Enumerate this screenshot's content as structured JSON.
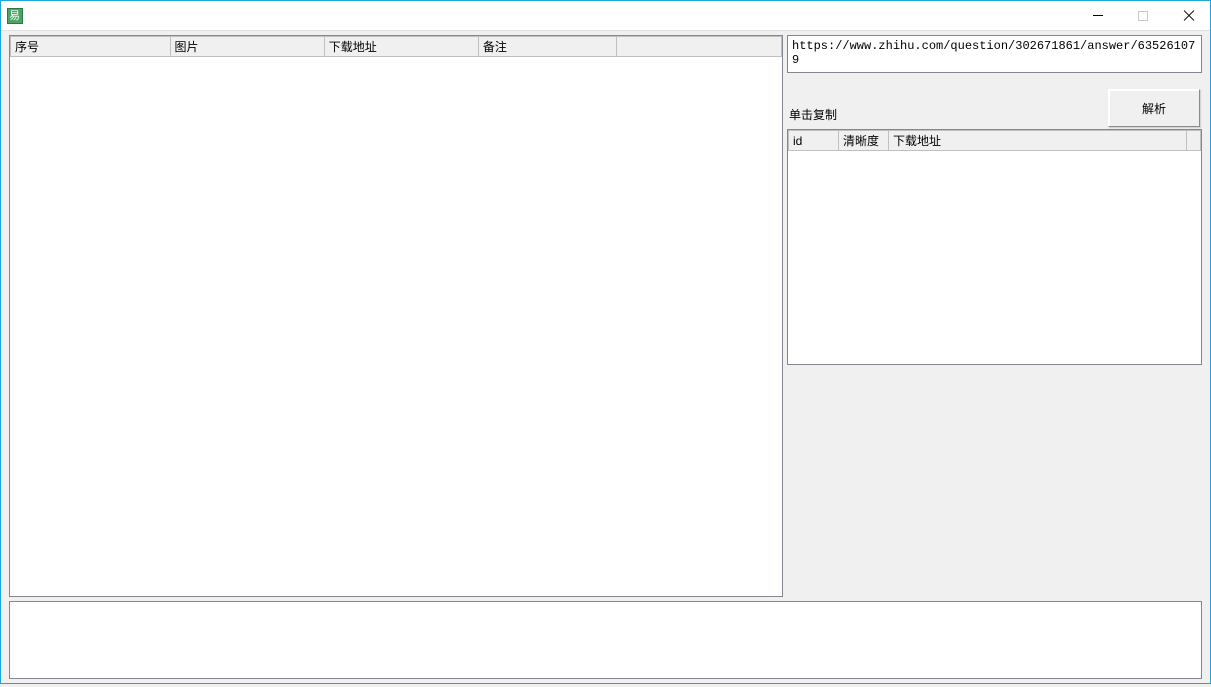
{
  "window": {
    "title": ""
  },
  "left_table": {
    "columns": {
      "index": "序号",
      "image": "图片",
      "download_url": "下载地址",
      "remark": "备注"
    }
  },
  "url_input": {
    "value": "https://www.zhihu.com/question/302671861/answer/635261079"
  },
  "action": {
    "copy_label": "单击复制",
    "parse_label": "解析"
  },
  "result_table": {
    "columns": {
      "id": "id",
      "quality": "清晰度",
      "download_url": "下载地址"
    }
  }
}
